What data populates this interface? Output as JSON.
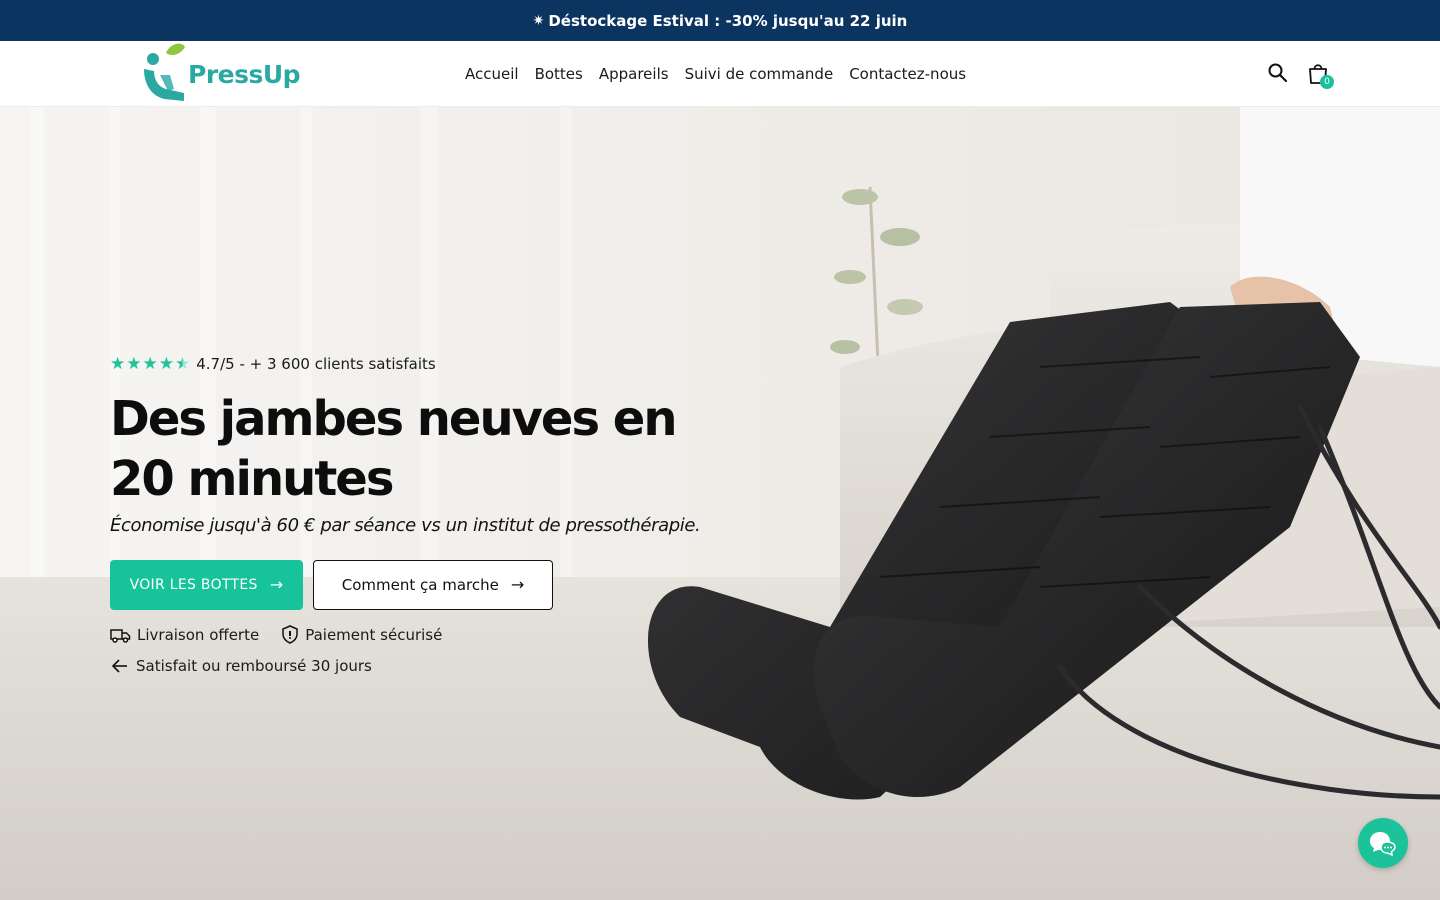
{
  "announcement": {
    "icon": "snowflake-icon",
    "glyph": "✷",
    "text": "Déstockage Estival : -30% jusqu'au 22 juin"
  },
  "header": {
    "logo_text": "PressUp",
    "nav": [
      "Accueil",
      "Bottes",
      "Appareils",
      "Suivi de commande",
      "Contactez-nous"
    ],
    "cart_count": "0"
  },
  "hero": {
    "rating_stars": 4.5,
    "rating_text": "4.7/5 - + 3 600 clients satisfaits",
    "headline": "Des jambes neuves en 20 minutes",
    "subline": "Économise jusqu'à 60 € par séance vs un institut de pressothérapie.",
    "primary_cta": "VOIR LES BOTTES",
    "secondary_cta": "Comment ça marche",
    "arrow": "→",
    "features": [
      {
        "icon": "truck-icon",
        "label": "Livraison offerte"
      },
      {
        "icon": "shield-icon",
        "label": "Paiement sécurisé"
      },
      {
        "icon": "arrow-left-icon",
        "label": "Satisfait ou remboursé 30 jours"
      }
    ]
  },
  "colors": {
    "announcement_bg": "#0c3461",
    "accent": "#16c39a",
    "logo": "#2aa9a3"
  }
}
